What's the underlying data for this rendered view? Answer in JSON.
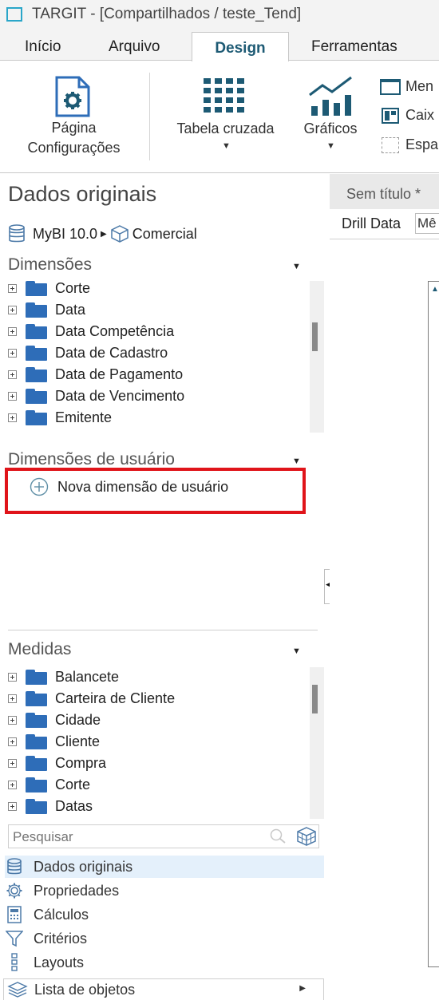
{
  "window": {
    "title": "TARGIT - [Compartilhados / teste_Tend]"
  },
  "tabs": [
    "Início",
    "Arquivo",
    "Design",
    "Ferramentas"
  ],
  "active_tab": "Design",
  "ribbon": {
    "page_settings_line1": "Página",
    "page_settings_line2": "Configurações",
    "crosstab_label": "Tabela cruzada",
    "charts_label": "Gráficos",
    "small_items": [
      "Men",
      "Caix",
      "Espa"
    ]
  },
  "panel": {
    "title": "Dados originais",
    "source": "MyBI 10.0",
    "cube": "Comercial",
    "dimensions_heading": "Dimensões",
    "dimensions": [
      "Corte",
      "Data",
      "Data Competência",
      "Data de Cadastro",
      "Data de Pagamento",
      "Data de Vencimento",
      "Emitente"
    ],
    "user_dimensions_heading": "Dimensões de usuário",
    "new_user_dimension": "Nova dimensão de usuário",
    "measures_heading": "Medidas",
    "measures": [
      "Balancete",
      "Carteira de Cliente",
      "Cidade",
      "Cliente",
      "Compra",
      "Corte",
      "Datas"
    ],
    "search_placeholder": "Pesquisar",
    "nav": [
      "Dados originais",
      "Propriedades",
      "Cálculos",
      "Critérios",
      "Layouts"
    ],
    "object_list": "Lista de objetos"
  },
  "document": {
    "tab_title": "Sem título *",
    "drill_label": "Drill Data",
    "drill_value": "Mê"
  },
  "colors": {
    "accent": "#1d5a74",
    "folder": "#2e6db8",
    "highlight": "#e4f0fb",
    "callout": "#e0141a"
  }
}
